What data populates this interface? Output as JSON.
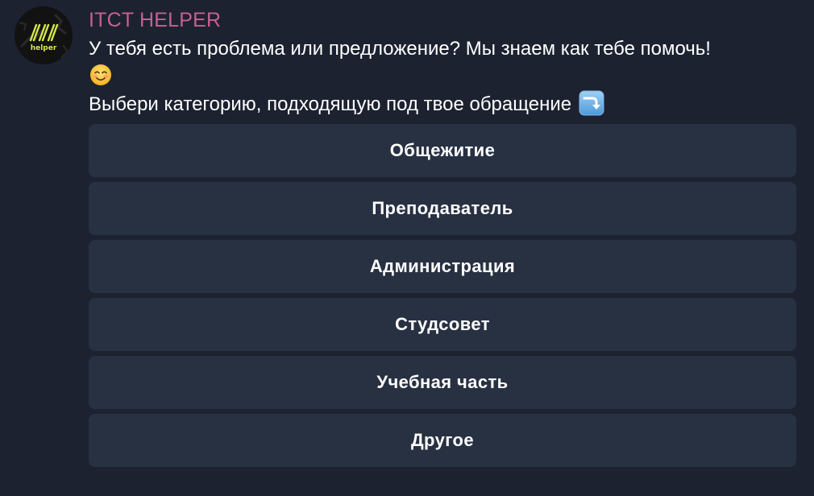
{
  "message": {
    "sender": "ITCT HELPER",
    "avatar_text": "helper",
    "line1": "У тебя есть проблема или предложение? Мы знаем как тебе помочь!",
    "line2_icon": "smiling-face-emoji",
    "line3": "Выбери категорию, подходящую под твое обращение",
    "line3_icon": "arrow-right-curving-down-emoji"
  },
  "keyboard": {
    "buttons": [
      {
        "label": "Общежитие"
      },
      {
        "label": "Преподаватель"
      },
      {
        "label": "Администрация"
      },
      {
        "label": "Студсовет"
      },
      {
        "label": "Учебная часть"
      },
      {
        "label": "Другое"
      }
    ]
  },
  "colors": {
    "background": "#1c2230",
    "sender_name": "#c85f95",
    "button_background": "#283142",
    "avatar_accent": "#d6e84a"
  }
}
